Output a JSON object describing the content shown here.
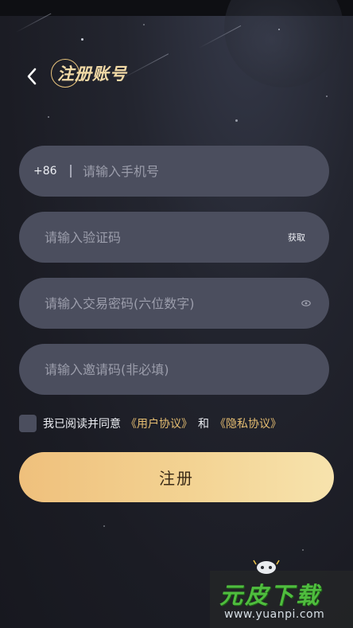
{
  "header": {
    "title": "注册账号"
  },
  "form": {
    "phone": {
      "country_code": "+86",
      "placeholder": "请输入手机号"
    },
    "verify_code": {
      "placeholder": "请输入验证码",
      "get_code_label": "获取"
    },
    "password": {
      "placeholder": "请输入交易密码(六位数字)"
    },
    "invite_code": {
      "placeholder": "请输入邀请码(非必填)"
    }
  },
  "agreement": {
    "prefix": "我已阅读并同意",
    "user_agreement": "《用户协议》",
    "and": "和",
    "privacy_policy": "《隐私协议》",
    "checked": false
  },
  "register_button": {
    "label": "注册"
  },
  "watermark": {
    "brand": "元皮下载",
    "url": "www.yuanpi.com"
  },
  "colors": {
    "background": "#1b1c24",
    "field_background": "#4b4e5e",
    "accent_gold": "#e6be72",
    "button_gradient_start": "#efc07c",
    "button_gradient_end": "#f7e3ad"
  }
}
